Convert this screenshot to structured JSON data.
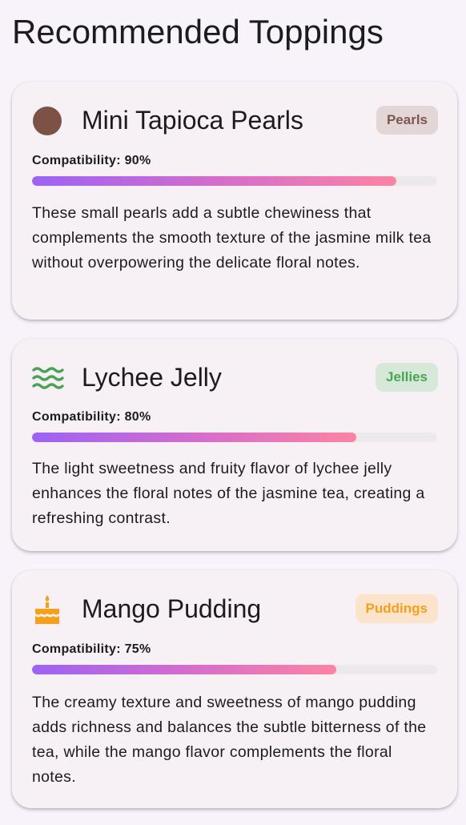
{
  "page": {
    "title": "Recommended Toppings"
  },
  "cards": [
    {
      "icon": "pearl-icon",
      "title": "Mini Tapioca Pearls",
      "category": "Pearls",
      "category_color": "#7d574d",
      "category_bg": "#e3d6d7",
      "compatibility_label": "Compatibility: 90%",
      "compatibility": 0.9,
      "description": "These small pearls add a subtle chewiness that complements the smooth texture of the jasmine milk tea without overpowering the delicate floral notes."
    },
    {
      "icon": "waves-icon",
      "title": "Lychee Jelly",
      "category": "Jellies",
      "category_color": "#4aa456",
      "category_bg": "#d6e8d8",
      "compatibility_label": "Compatibility: 80%",
      "compatibility": 0.8,
      "description": "The light sweetness and fruity flavor of lychee jelly enhances the floral notes of the jasmine tea, creating a refreshing contrast."
    },
    {
      "icon": "cake-icon",
      "title": "Mango Pudding",
      "category": "Puddings",
      "category_color": "#f6a01a",
      "category_bg": "#fbe3cc",
      "compatibility_label": "Compatibility: 75%",
      "compatibility": 0.75,
      "description": "The creamy texture and sweetness of mango pudding adds richness and balances the subtle bitterness of the tea, while the mango flavor complements the floral notes."
    }
  ],
  "colors": {
    "background": "#f8f3fb",
    "card": "#f7f1f6",
    "bar_gradient_start": "#9c63f4",
    "bar_gradient_end": "#fb84a4",
    "bar_track": "#ece9ec"
  }
}
